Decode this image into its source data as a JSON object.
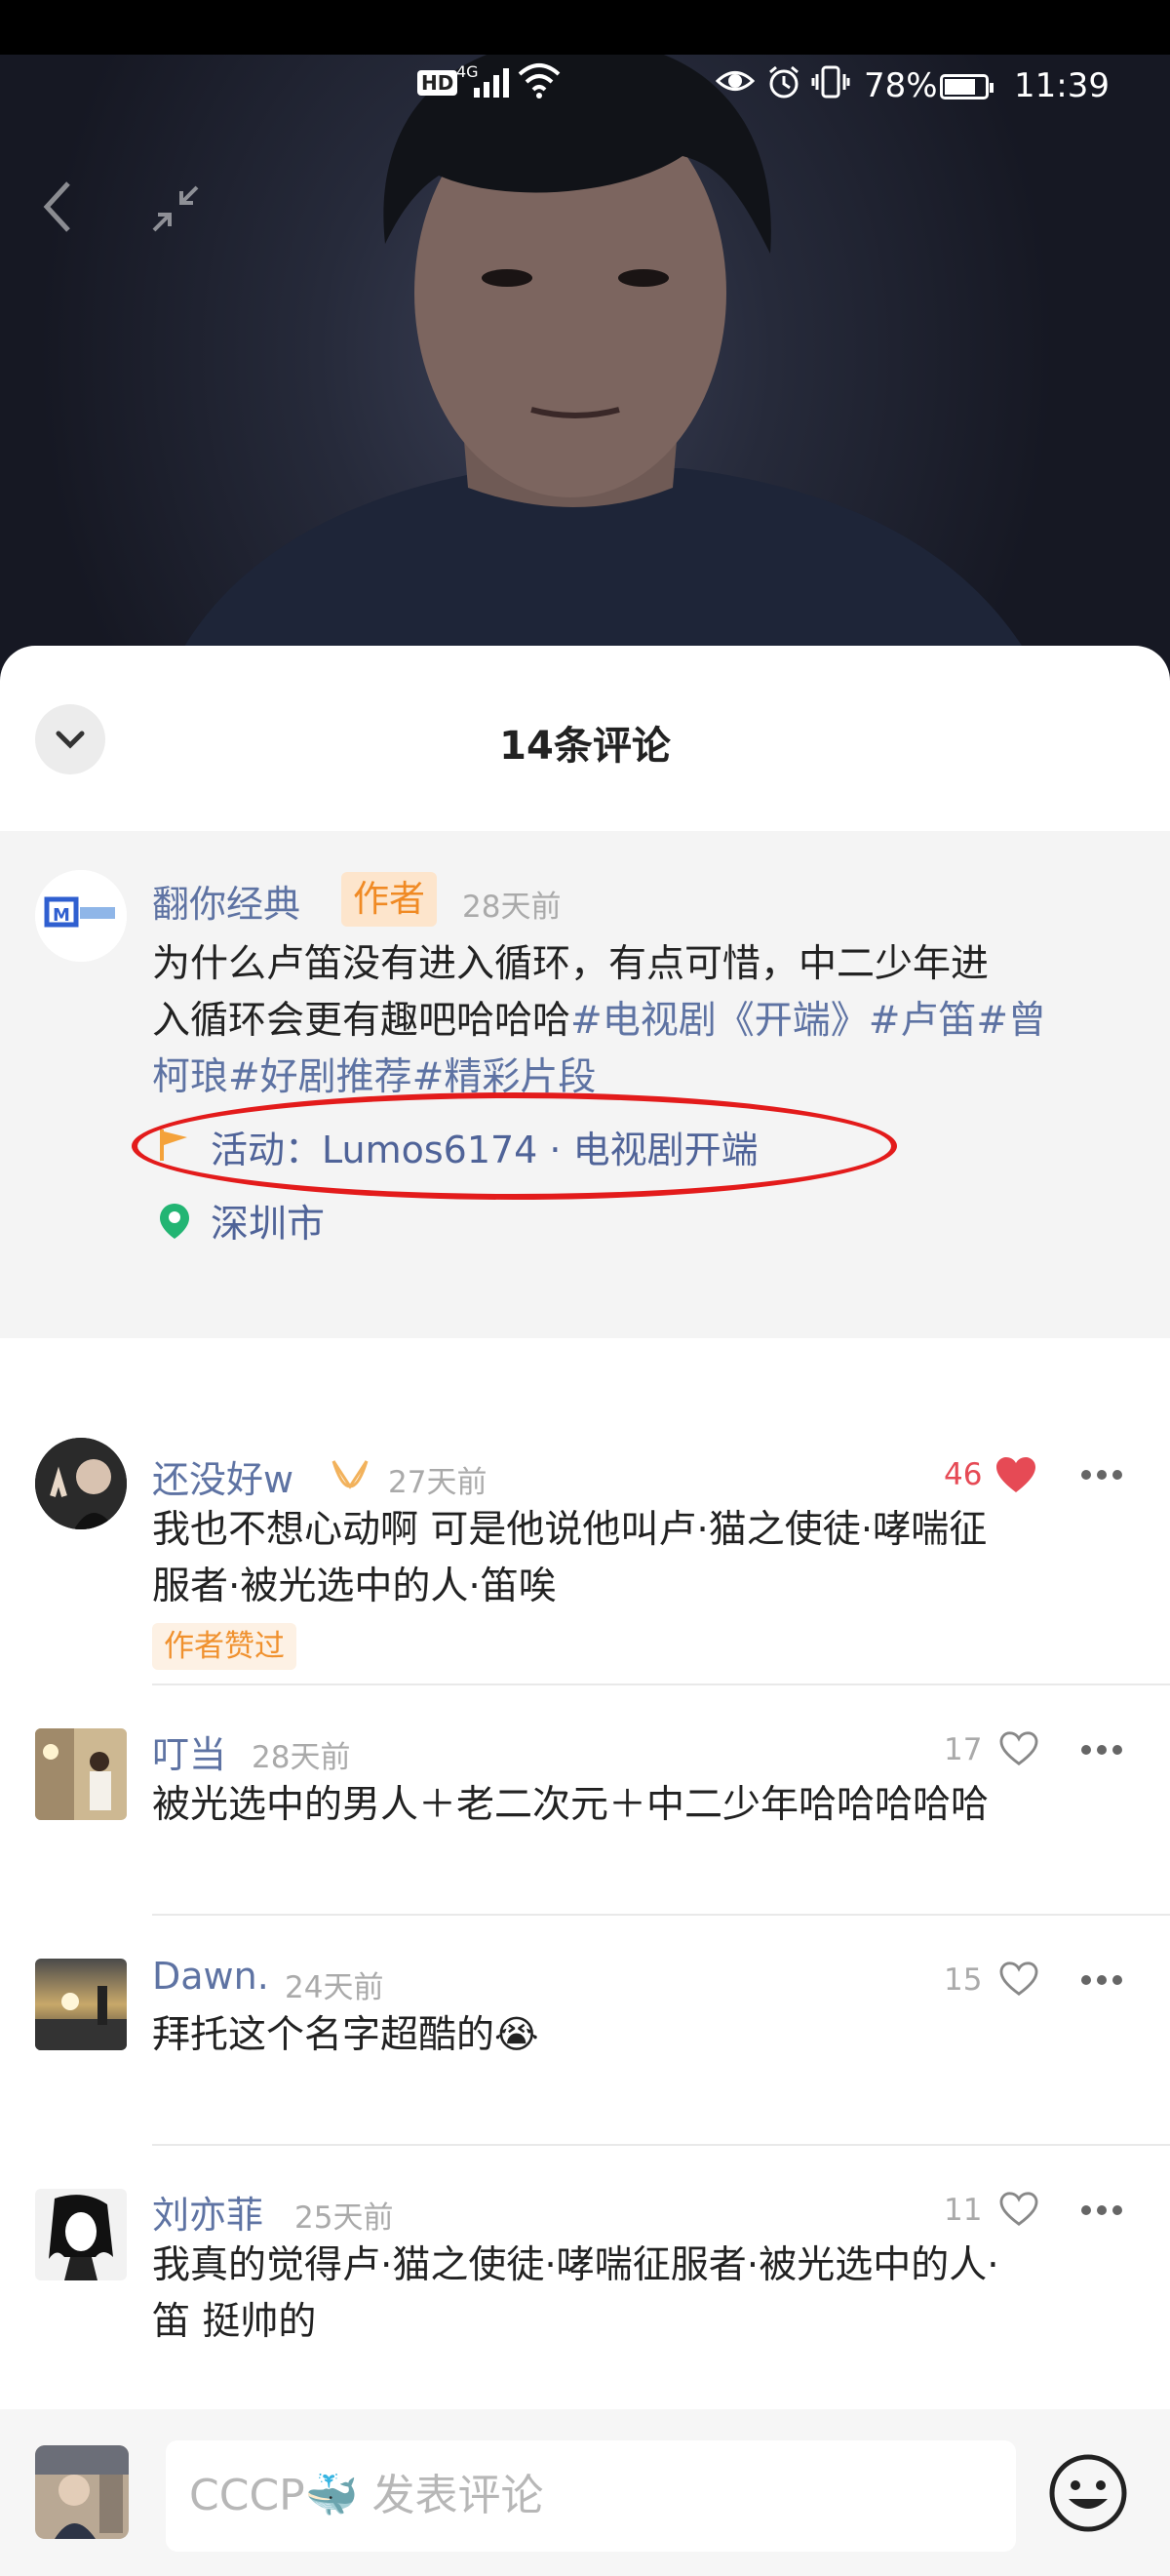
{
  "status_bar": {
    "hd": "HD",
    "network": "4G",
    "battery_percent": "78%",
    "battery_level": 0.78,
    "time": "11:39"
  },
  "video": {
    "back_icon": "chevron-left-icon",
    "shrink_icon": "shrink-arrows-icon"
  },
  "sheet": {
    "title": "14条评论",
    "collapse_icon": "chevron-down-icon"
  },
  "post": {
    "author": "翻你经典",
    "author_badge": "作者",
    "time": "28天前",
    "text_line1": "为什么卢笛没有进入循环，有点可惜，中二少年进",
    "text_line2_plain": "入循环会更有趣吧哈哈哈",
    "text_line2_tags": "#电视剧《开端》#卢笛#曾",
    "text_line3_tags": "柯琅#好剧推荐#精彩片段",
    "activity": "活动：Lumos6174 · 电视剧开端",
    "location": "深圳市"
  },
  "comments": [
    {
      "user": "还没好w",
      "time": "27天前",
      "likes": "46",
      "liked": true,
      "line1": "我也不想心动啊 可是他说他叫卢·猫之使徒·哮喘征",
      "line2": "服者·被光选中的人·笛唉",
      "badge": "作者赞过"
    },
    {
      "user": "叮当",
      "time": "28天前",
      "likes": "17",
      "liked": false,
      "line1": "被光选中的男人＋老二次元＋中二少年哈哈哈哈哈"
    },
    {
      "user": "Dawn.",
      "time": "24天前",
      "likes": "15",
      "liked": false,
      "line1": "拜托这个名字超酷的😭"
    },
    {
      "user": "刘亦菲",
      "time": "25天前",
      "likes": "11",
      "liked": false,
      "line1": "我真的觉得卢·猫之使徒·哮喘征服者·被光选中的人·",
      "line2": "笛 挺帅的"
    }
  ],
  "composer": {
    "placeholder": "CCCP🐳 发表评论",
    "emoji_icon": "smiley-icon"
  },
  "colors": {
    "link": "#5e73a3",
    "like_red": "#e64a55",
    "badge_orange": "#f08a24",
    "annotation_red": "#e31b1b"
  }
}
